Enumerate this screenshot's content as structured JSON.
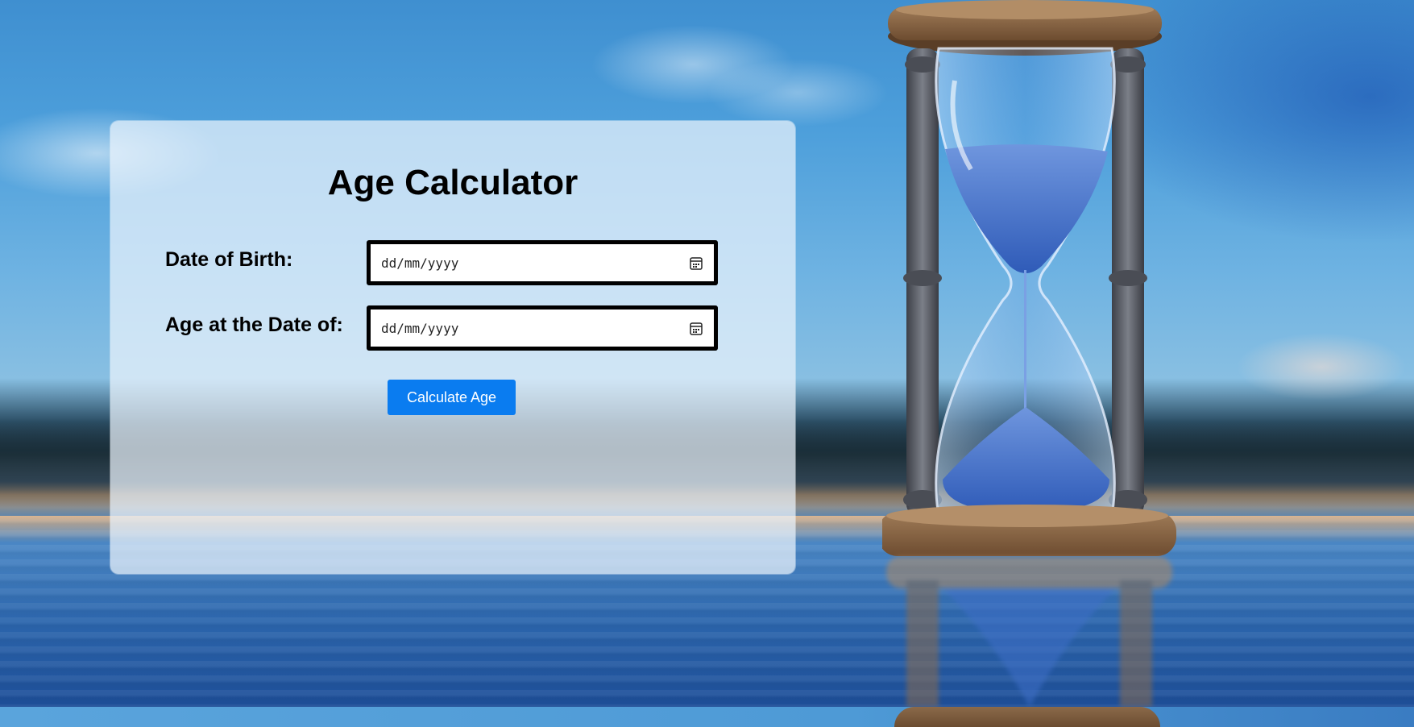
{
  "page": {
    "title": "Age Calculator"
  },
  "form": {
    "date_of_birth_label": "Date of Birth:",
    "date_of_birth_placeholder": "dd/mm/yyyy",
    "age_at_label": "Age at the Date of:",
    "age_at_placeholder": "dd/mm/yyyy",
    "calculate_button": "Calculate Age"
  },
  "icons": {
    "date_picker": "calendar-icon",
    "background": "hourglass-illustration"
  },
  "colors": {
    "accent": "#0a7cf0",
    "sand": "#3f6fc8"
  }
}
